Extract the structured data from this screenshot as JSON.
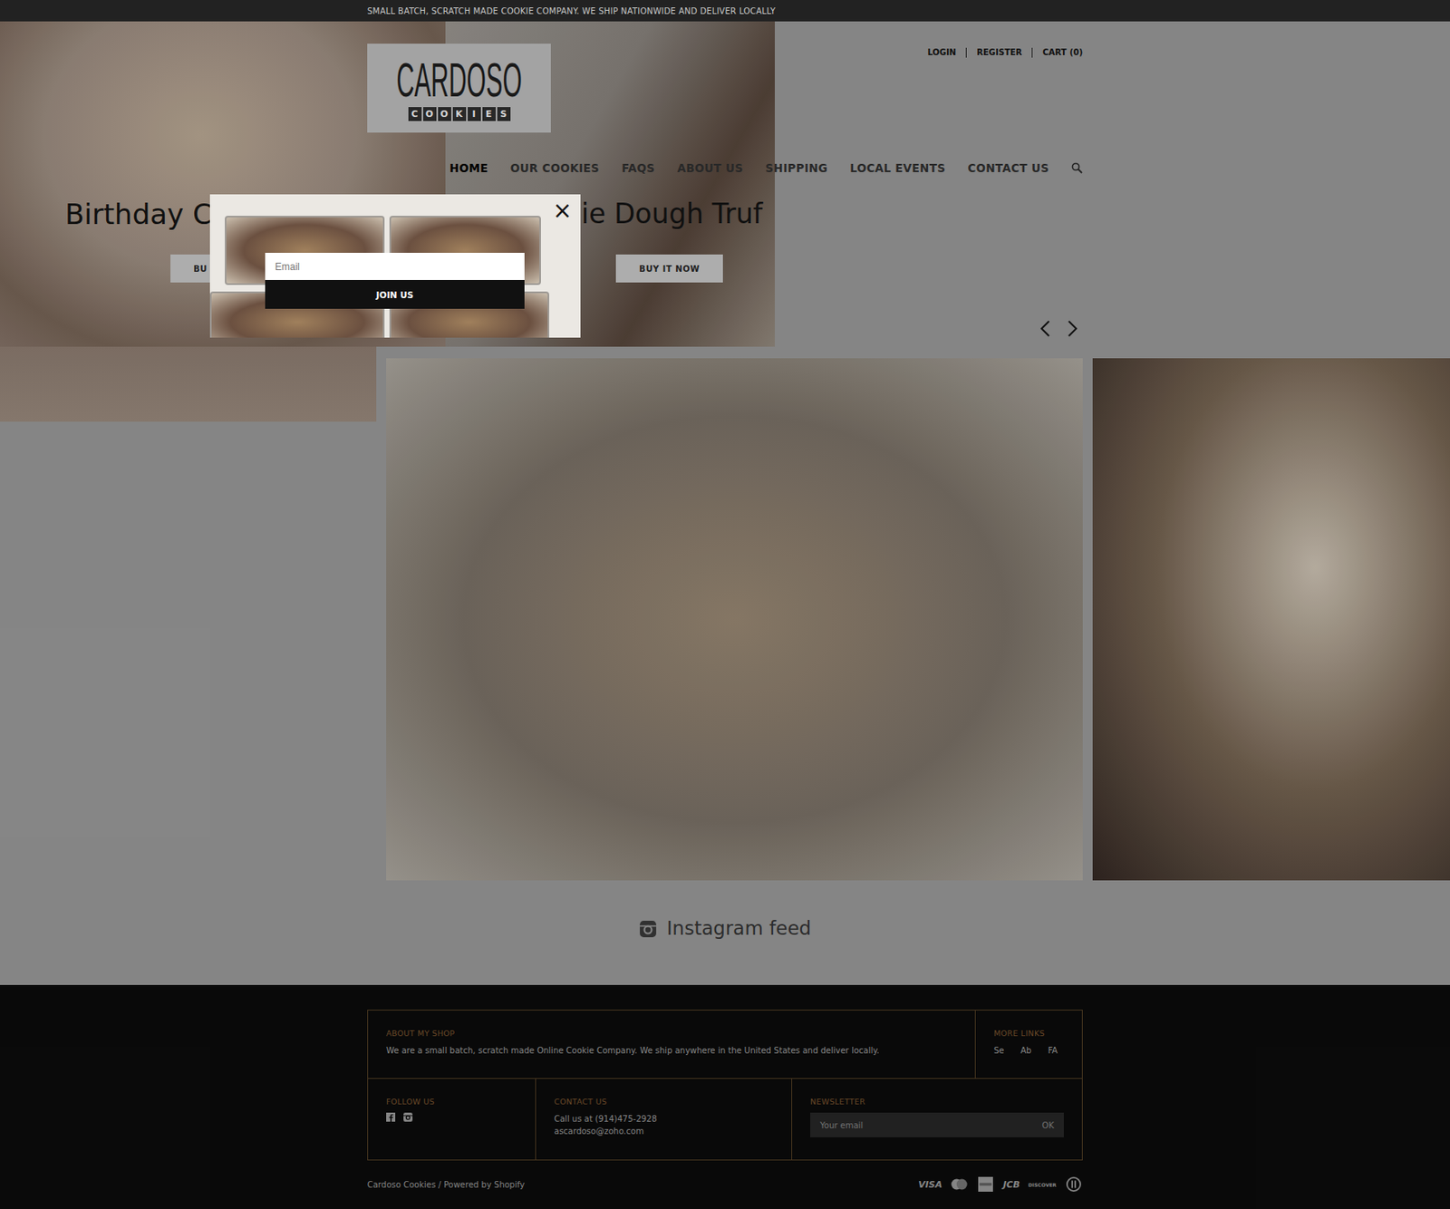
{
  "announcement": "SMALL BATCH, SCRATCH MADE COOKIE COMPANY. WE SHIP NATIONWIDE AND DELIVER LOCALLY",
  "logo": {
    "name": "CARDOSO",
    "tagline": [
      "C",
      "O",
      "O",
      "K",
      "I",
      "E",
      "S"
    ]
  },
  "account_links": [
    "LOGIN",
    "REGISTER",
    "CART (0)"
  ],
  "nav": [
    {
      "label": "HOME",
      "selected": true
    },
    {
      "label": "OUR COOKIES",
      "selected": false
    },
    {
      "label": "FAQS",
      "selected": false
    },
    {
      "label": "ABOUT US",
      "selected": false
    },
    {
      "label": "SHIPPING",
      "selected": false
    },
    {
      "label": "LOCAL EVENTS",
      "selected": false
    },
    {
      "label": "CONTACT US",
      "selected": false
    }
  ],
  "slides": [
    {
      "title": "Birthday C",
      "button": "BU"
    },
    {
      "title": "ie Dough Truf",
      "button": "BUY IT NOW"
    }
  ],
  "instagram": {
    "title": "Instagram feed"
  },
  "footer": {
    "about": {
      "title": "ABOUT MY SHOP",
      "text": "We are a small batch, scratch made Online Cookie Company. We ship anywhere in the United States and deliver locally."
    },
    "more_links": {
      "title": "MORE LINKS",
      "items": [
        "Se",
        "Ab",
        "FA"
      ]
    },
    "follow": {
      "title": "FOLLOW US"
    },
    "contact": {
      "title": "CONTACT US",
      "lines": [
        "Call us at (914)475-2928",
        "ascardoso@zoho.com"
      ]
    },
    "newsletter": {
      "title": "NEWSLETTER",
      "placeholder": "Your email",
      "button": "OK"
    },
    "copyright": "Cardoso Cookies / Powered by Shopify",
    "payments": [
      {
        "kind": "text",
        "label": "VISA"
      },
      {
        "kind": "mastercard",
        "label": ""
      },
      {
        "kind": "amex",
        "label": ""
      },
      {
        "kind": "text",
        "label": "JCB"
      },
      {
        "kind": "small",
        "label": "DISCOVER"
      },
      {
        "kind": "diners",
        "label": ""
      }
    ]
  },
  "popup": {
    "close": "×",
    "placeholder": "Email",
    "button": "JOIN US"
  }
}
